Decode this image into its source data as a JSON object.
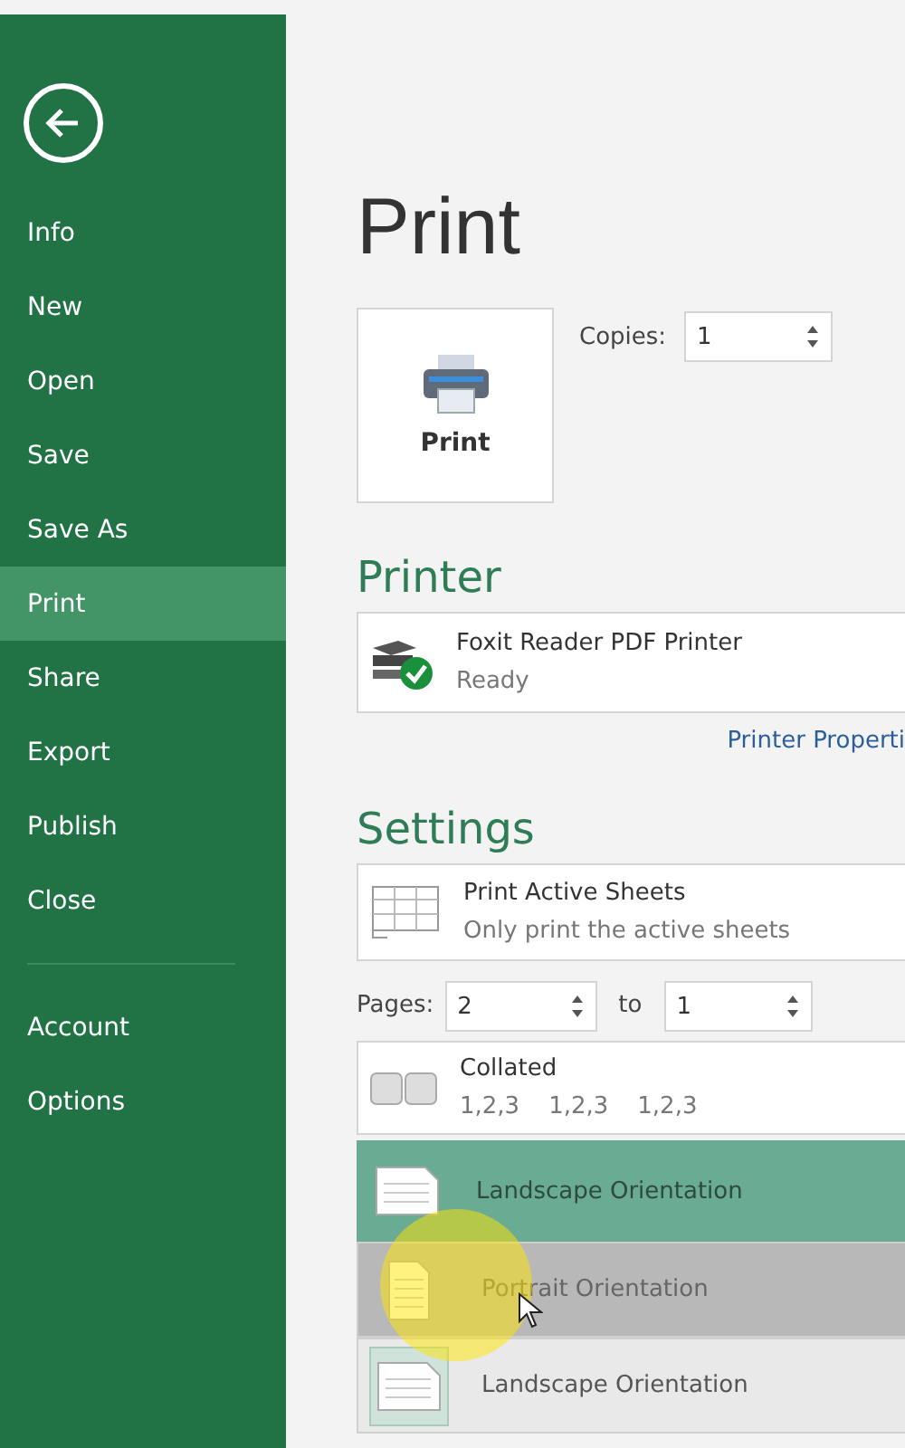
{
  "sidebar": {
    "items": [
      {
        "label": "Info",
        "selected": false
      },
      {
        "label": "New",
        "selected": false
      },
      {
        "label": "Open",
        "selected": false
      },
      {
        "label": "Save",
        "selected": false
      },
      {
        "label": "Save As",
        "selected": false
      },
      {
        "label": "Print",
        "selected": true
      },
      {
        "label": "Share",
        "selected": false
      },
      {
        "label": "Export",
        "selected": false
      },
      {
        "label": "Publish",
        "selected": false
      },
      {
        "label": "Close",
        "selected": false
      }
    ],
    "bottom_items": [
      {
        "label": "Account",
        "selected": false
      },
      {
        "label": "Options",
        "selected": false
      }
    ]
  },
  "title": "Print",
  "print_button": "Print",
  "copies": {
    "label": "Copies:",
    "value": "1"
  },
  "printer": {
    "heading": "Printer",
    "name": "Foxit Reader PDF Printer",
    "status": "Ready",
    "properties_link": "Printer Properti"
  },
  "settings": {
    "heading": "Settings",
    "sheets": {
      "title": "Print Active Sheets",
      "subtitle": "Only print the active sheets"
    },
    "pages": {
      "label": "Pages:",
      "from": "2",
      "to_label": "to",
      "to": "1"
    },
    "collation": {
      "title": "Collated",
      "sequence": [
        "1,2,3",
        "1,2,3",
        "1,2,3"
      ]
    },
    "orientation": {
      "value": "Landscape Orientation",
      "expanded": true,
      "options": [
        {
          "label": "Portrait Orientation",
          "kind": "portrait",
          "selected": false,
          "hovered": true
        },
        {
          "label": "Landscape Orientation",
          "kind": "landscape",
          "selected": true,
          "hovered": false
        }
      ]
    }
  }
}
